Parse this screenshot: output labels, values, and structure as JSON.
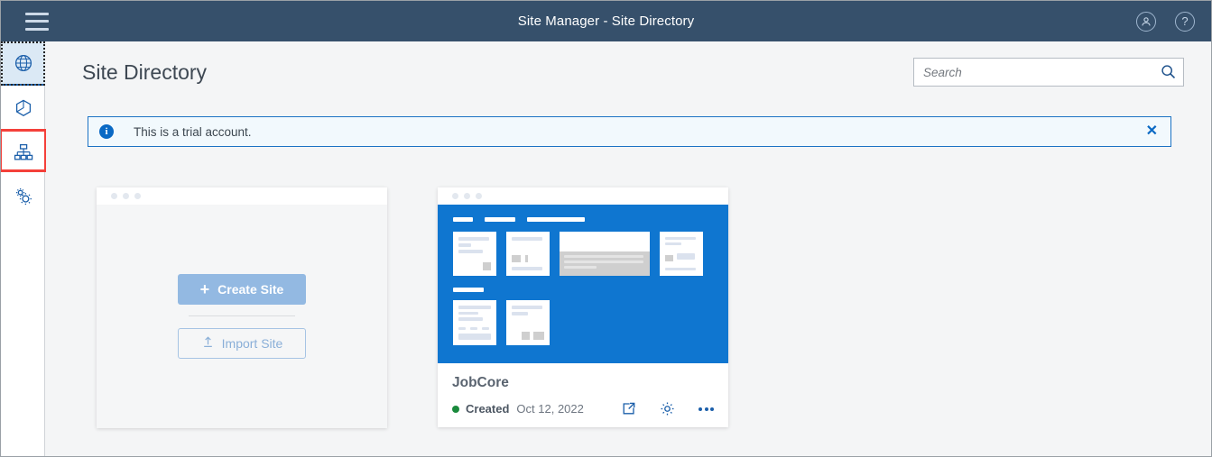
{
  "topbar": {
    "title": "Site Manager - Site Directory",
    "menu_icon": "hamburger-icon",
    "account_icon": "account-circle-icon",
    "help_icon": "help-circle-icon"
  },
  "sidebar": {
    "items": [
      {
        "name": "sidebar-item-globe",
        "icon": "globe-icon",
        "active": true
      },
      {
        "name": "sidebar-item-assets",
        "icon": "hexagon-cube-icon",
        "active": false
      },
      {
        "name": "sidebar-item-site-directory",
        "icon": "sitemap-icon",
        "active": false,
        "highlighted": true
      },
      {
        "name": "sidebar-item-settings",
        "icon": "gears-icon",
        "active": false
      }
    ]
  },
  "page": {
    "title": "Site Directory"
  },
  "search": {
    "placeholder": "Search",
    "value": "",
    "icon": "search-icon"
  },
  "banner": {
    "icon": "info-icon",
    "info_glyph": "i",
    "message": "This is a trial account.",
    "close_glyph": "✕",
    "border_color": "#1c72c4",
    "background_color": "#f2f9fd"
  },
  "create_card": {
    "create_label": "Create Site",
    "create_plus": "+",
    "create_color": "#93b9e2",
    "import_label": "Import Site",
    "import_icon": "upload-icon"
  },
  "site_card": {
    "name": "JobCore",
    "status": "Created",
    "status_color": "#1a8a3c",
    "date": "Oct 12, 2022",
    "thumbnail_color": "#0f76d0",
    "actions": [
      {
        "name": "open-external-button",
        "icon": "external-link-icon"
      },
      {
        "name": "settings-button",
        "icon": "gear-icon"
      },
      {
        "name": "more-options-button",
        "icon": "more-horizontal-icon"
      }
    ]
  }
}
